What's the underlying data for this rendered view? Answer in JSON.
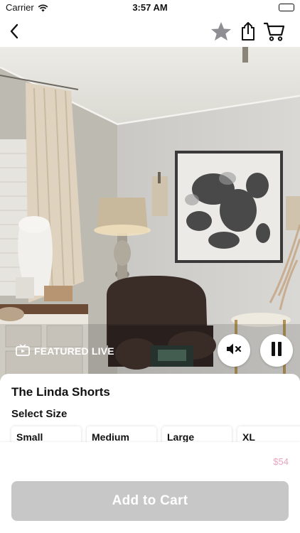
{
  "status_bar": {
    "carrier": "Carrier",
    "time": "3:57 AM"
  },
  "nav": {
    "icons": [
      "back-chevron-icon",
      "star-icon",
      "share-icon",
      "cart-icon"
    ]
  },
  "video": {
    "badge_label": "FEATURED LIVE",
    "badge_icon": "tv-icon",
    "controls": [
      "mute-icon",
      "pause-icon"
    ]
  },
  "product": {
    "title": "The Linda Shorts",
    "select_size_label": "Select Size",
    "sizes": [
      "Small",
      "Medium",
      "Large",
      "XL"
    ],
    "price": "$54",
    "add_to_cart_label": "Add to Cart",
    "colors": {
      "price": "#e9a4bf",
      "button_disabled": "#c7c7c7"
    }
  }
}
